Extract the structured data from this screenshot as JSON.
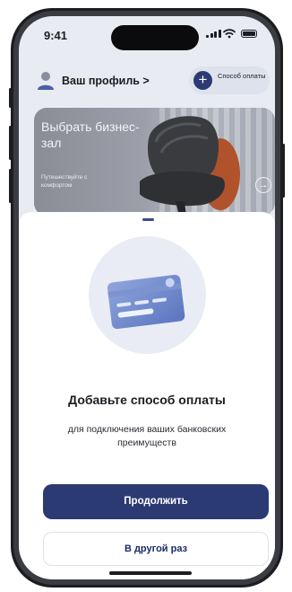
{
  "status_bar": {
    "time": "9:41"
  },
  "header": {
    "profile_label": "Ваш профиль >",
    "add_payment_label": "Способ оплаты",
    "add_payment_icon": "plus-icon"
  },
  "banner": {
    "title": "Выбрать бизнес-зал",
    "subtitle": "Путешествуйте с комфортом",
    "arrow_icon": "arrow-right-icon"
  },
  "sheet": {
    "title": "Добавьте способ оплаты",
    "subtitle": "для подключения ваших банковских преимуществ",
    "primary_button": "Продолжить",
    "secondary_button": "В другой раз"
  },
  "colors": {
    "accent": "#2c3a74",
    "background": "#e8ebf2"
  }
}
